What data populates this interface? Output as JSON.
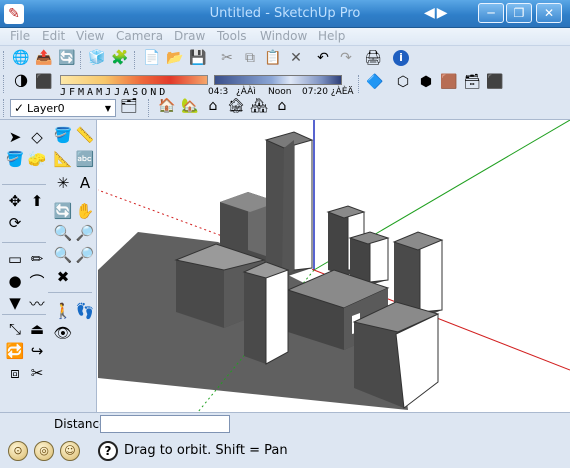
{
  "window": {
    "title": "Untitled - SketchUp Pro",
    "nav_arrows": "◀▶",
    "minimize": "─",
    "restore": "❐",
    "close": "✕"
  },
  "menu": {
    "items": [
      "File",
      "Edit",
      "View",
      "Camera",
      "Draw",
      "Tools",
      "Window",
      "Help"
    ]
  },
  "shadows": {
    "months": "JFMAMJJASOND",
    "time_start": "04:3",
    "time_mark1": "¿ÀÀì",
    "time_noon": "Noon",
    "time_end": "07:20 ¿ÀÈÄ"
  },
  "layers": {
    "current": "Layer0",
    "check": "✓"
  },
  "measurements": {
    "label": "Distance",
    "value": ""
  },
  "status": {
    "help_icon": "?",
    "text": "Drag to orbit.  Shift = Pan"
  },
  "colors": {
    "titlebar": "#2f7fc9",
    "toolbar_bg": "#dde6f2",
    "ground_shadow": "#606060",
    "building_face_light": "#ffffff",
    "building_face_mid": "#8a8a8a",
    "building_face_dark": "#4a4a4a",
    "axis_red": "#d22020",
    "axis_green": "#20a020",
    "axis_blue": "#2030c0"
  }
}
